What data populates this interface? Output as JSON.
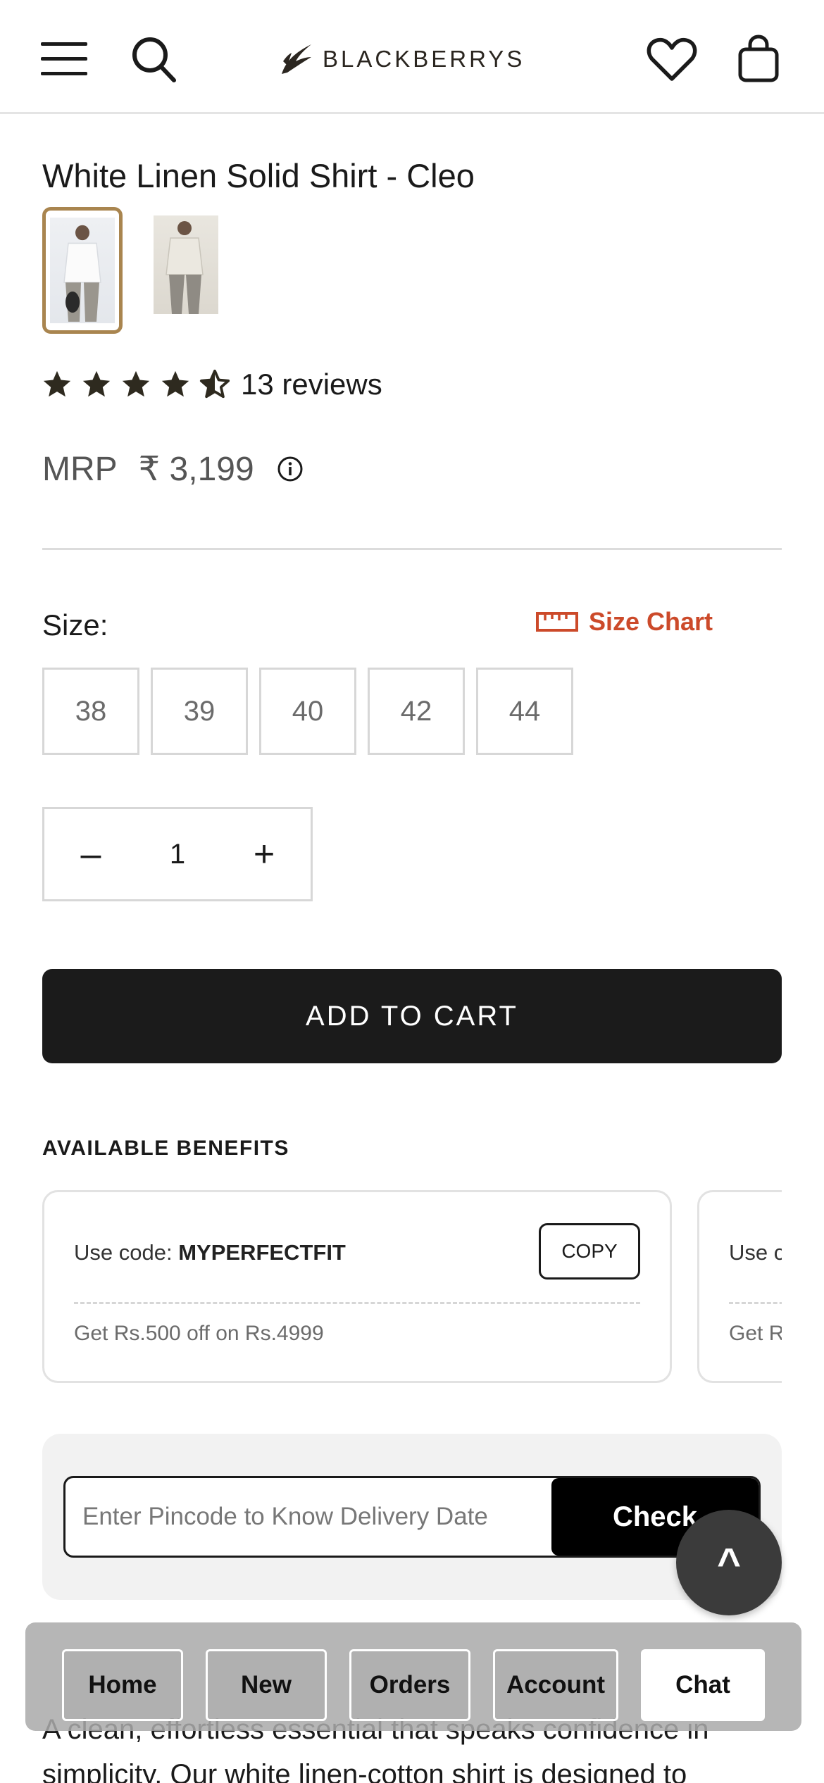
{
  "header": {
    "brand": "BLACKBERRYS",
    "icons": [
      "menu-icon",
      "search-icon",
      "heart-icon",
      "bag-icon"
    ]
  },
  "product": {
    "title": "White Linen Solid Shirt - Cleo",
    "rating": 4.5,
    "reviews_label": "13 reviews",
    "mrp_label": "MRP",
    "price": "₹ 3,199"
  },
  "size": {
    "label": "Size:",
    "chart_label": "Size Chart",
    "options": [
      "38",
      "39",
      "40",
      "42",
      "44"
    ]
  },
  "quantity": {
    "minus": "–",
    "value": "1",
    "plus": "+"
  },
  "cart": {
    "add_label": "ADD TO CART"
  },
  "benefits": {
    "heading": "AVAILABLE BENEFITS",
    "cards": [
      {
        "code_prefix": "Use code: ",
        "code": "MYPERFECTFIT",
        "copy_label": "COPY",
        "description": "Get Rs.500 off on Rs.4999"
      },
      {
        "code_prefix": "Use c",
        "description": "Get R"
      }
    ]
  },
  "pincode": {
    "placeholder": "Enter Pincode to Know Delivery Date",
    "check_label": "Check"
  },
  "scroll_top": {
    "label": "^"
  },
  "description": {
    "text": "A clean, effortless essential that speaks confidence in simplicity. Our white linen-cotton shirt is designed to"
  },
  "bottom_nav": {
    "home": "Home",
    "new": "New",
    "orders": "Orders",
    "account": "Account",
    "chat": "Chat"
  },
  "colors": {
    "accent_thumb_border": "#a9854f",
    "size_chart": "#cc4a2a",
    "button_dark": "#1b1b1b",
    "star": "#2e2a1f"
  }
}
